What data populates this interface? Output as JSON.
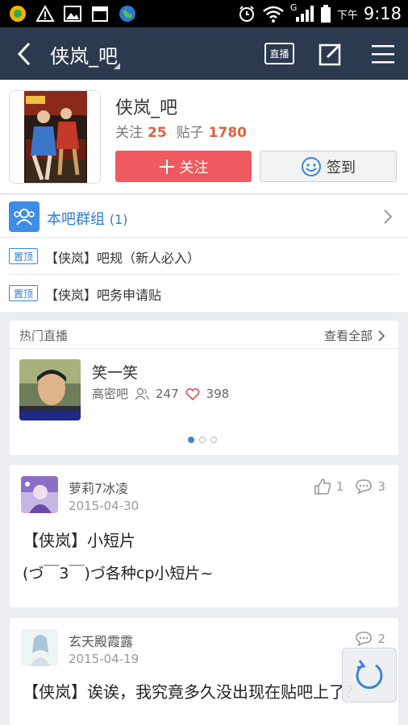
{
  "status_bar": {
    "time": "9:18",
    "ampm": "下午",
    "signal_label": "G"
  },
  "nav": {
    "title": "侠岚_吧",
    "live_label": "直播"
  },
  "forum": {
    "name": "侠岚_吧",
    "follow_label": "关注",
    "follow_count": "25",
    "posts_label": "贴子",
    "posts_count": "1780",
    "follow_button": "关注",
    "sign_button": "签到"
  },
  "group": {
    "label": "本吧群组",
    "count": "(1)"
  },
  "pinned": [
    {
      "badge": "置顶",
      "text": "【侠岚】吧规（新人必入）"
    },
    {
      "badge": "置顶",
      "text": "【侠岚】吧务申请贴"
    }
  ],
  "live": {
    "section_title": "热门直播",
    "view_all": "查看全部",
    "item": {
      "name": "笑一笑",
      "forum": "高密吧",
      "viewers": "247",
      "likes": "398"
    },
    "page_count": 3,
    "active_page": 1
  },
  "posts": [
    {
      "user": "萝莉7冰凌",
      "date": "2015-04-30",
      "likes": "1",
      "comments": "3",
      "title": "【侠岚】小短片",
      "body": "(づ￣3￣)づ各种cp小短片~"
    },
    {
      "user": "玄天殿霞露",
      "date": "2015-04-19",
      "comments": "2",
      "title": "【侠岚】诶诶，我究竟多久没出现在贴吧上了？"
    }
  ],
  "colors": {
    "nav_bg": "#2b3a4f",
    "accent_blue": "#3a86d6",
    "follow_red": "#ee5a5f",
    "count_orange": "#e0603f"
  }
}
